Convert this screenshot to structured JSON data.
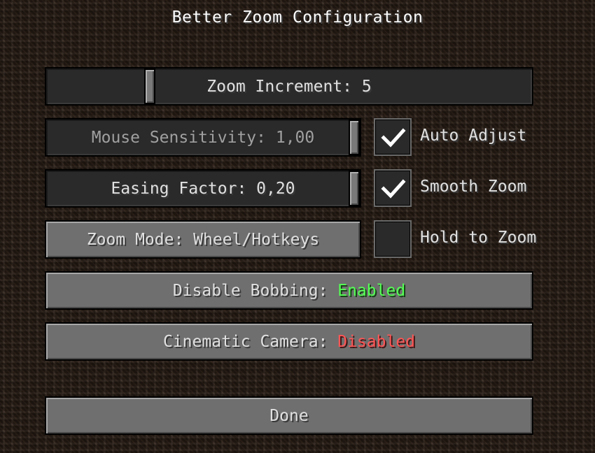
{
  "title": "Better Zoom Configuration",
  "zoom_increment": {
    "label": "Zoom Increment: 5",
    "value_fraction": 0.2
  },
  "mouse_sensitivity": {
    "label": "Mouse Sensitivity: 1,00",
    "value_fraction": 1.0,
    "disabled": true
  },
  "easing_factor": {
    "label": "Easing Factor: 0,20",
    "value_fraction": 1.0
  },
  "auto_adjust": {
    "label": "Auto Adjust",
    "checked": true
  },
  "smooth_zoom": {
    "label": "Smooth Zoom",
    "checked": true
  },
  "zoom_mode": {
    "label": "Zoom Mode: Wheel/Hotkeys"
  },
  "hold_to_zoom": {
    "label": "Hold to Zoom",
    "checked": false
  },
  "disable_bobbing": {
    "prefix": "Disable Bobbing: ",
    "state": "Enabled",
    "state_color": "#55ff55"
  },
  "cinematic_camera": {
    "prefix": "Cinematic Camera: ",
    "state": "Disabled",
    "state_color": "#ff5555"
  },
  "done": {
    "label": "Done"
  }
}
